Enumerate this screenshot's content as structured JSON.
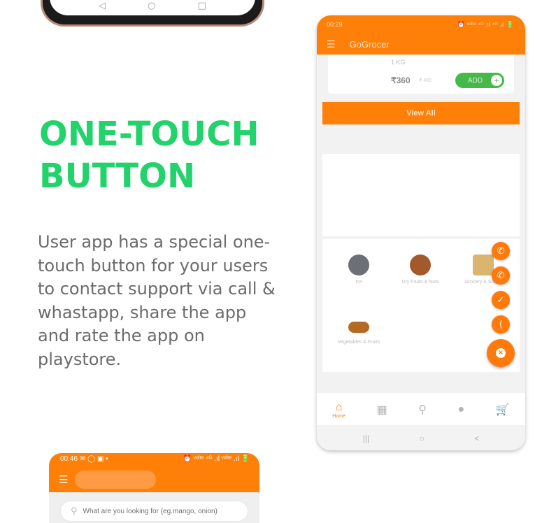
{
  "headline": {
    "line1": "ONE-TOUCH",
    "line2": "BUTTON"
  },
  "description": "User app has a special one-touch button for your users to contact support via call & whastapp, share the app and rate the app on playstore.",
  "top_phone": {
    "nav_back": "◁",
    "nav_home": "○",
    "nav_recent": "□"
  },
  "right_phone": {
    "status_time": "00:29",
    "status_icons": "⏰ ᵛᵒˡᵗᵉ ⁴ᴳ .ıl ⁴ᴳ .ıl 🔋",
    "app_title": "GoGrocer",
    "product": {
      "weight": "1 KG",
      "price": "₹360",
      "mrp": "₹ 400",
      "add_label": "ADD",
      "add_icon": "+"
    },
    "view_all": "View All",
    "categories": [
      {
        "label": "Ice",
        "color": "#6d6f77"
      },
      {
        "label": "Dry Fruits & Nuts",
        "color": "#a35a2a"
      },
      {
        "label": "Grocery & Staple",
        "color": "#d9b56f"
      },
      {
        "label": "Vegetables & Fruits",
        "color": "#b56a24"
      }
    ],
    "bottom_nav": {
      "home_label": "Home"
    },
    "system_nav": {
      "recent": "|||",
      "home": "○",
      "back": "<"
    },
    "fab": {
      "call": "✆",
      "whatsapp": "✆",
      "rate": "✓",
      "share": "⟨",
      "close": "×"
    },
    "accent": "#ff8008",
    "add_color": "#47b84a"
  },
  "bottom_phone": {
    "status_time": "00:46",
    "status_icons_left": "✉ ◯ ▣ •",
    "status_icons_right": "⏰ ᵛᵒˡᵗᵉ ⁴ᴳ .ıl ᵛᵒˡᵗᵉ .ıl 🔋",
    "search_placeholder": "What are you looking for (eg.mango, onion)"
  },
  "colors": {
    "headline": "#22d26b",
    "description": "#6b6b6b",
    "orange": "#ff8008"
  }
}
